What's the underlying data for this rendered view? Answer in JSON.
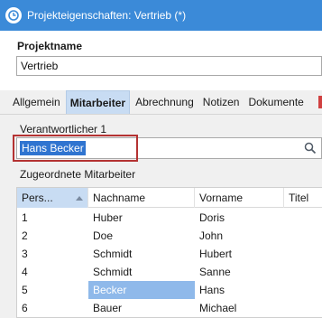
{
  "window": {
    "title": "Projekteigenschaften: Vertrieb (*)"
  },
  "project": {
    "label": "Projektname",
    "value": "Vertrieb"
  },
  "tabs": [
    {
      "label": "Allgemein",
      "active": false
    },
    {
      "label": "Mitarbeiter",
      "active": true
    },
    {
      "label": "Abrechnung",
      "active": false
    },
    {
      "label": "Notizen",
      "active": false
    },
    {
      "label": "Dokumente",
      "active": false
    }
  ],
  "responsible": {
    "label": "Verantwortlicher 1",
    "value": "Hans Becker"
  },
  "assigned": {
    "label": "Zugeordnete Mitarbeiter",
    "columns": [
      "Pers...",
      "Nachname",
      "Vorname",
      "Titel"
    ],
    "sort_column": "Pers...",
    "rows": [
      {
        "id": "1",
        "last": "Huber",
        "first": "Doris",
        "title": ""
      },
      {
        "id": "2",
        "last": "Doe",
        "first": "John",
        "title": ""
      },
      {
        "id": "3",
        "last": "Schmidt",
        "first": "Hubert",
        "title": ""
      },
      {
        "id": "4",
        "last": "Schmidt",
        "first": "Sanne",
        "title": ""
      },
      {
        "id": "5",
        "last": "Becker",
        "first": "Hans",
        "title": "",
        "selected_cell": "last"
      },
      {
        "id": "6",
        "last": "Bauer",
        "first": "Michael",
        "title": ""
      }
    ]
  },
  "colors": {
    "titlebar": "#3b8ad8",
    "active_tab": "#c8dcf3",
    "selection": "#2f74d0",
    "cell_selection": "#8fb9ea",
    "highlight_border": "#b43232"
  }
}
